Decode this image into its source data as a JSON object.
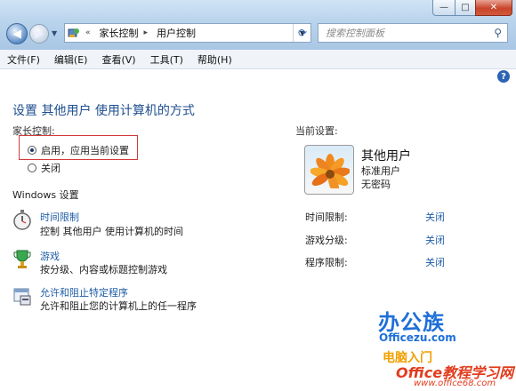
{
  "window": {
    "caption": {
      "minimize": "—",
      "maximize": "□",
      "close": "✕"
    }
  },
  "nav": {
    "breadcrumbs": [
      "家长控制",
      "用户控制"
    ],
    "breadcrumb_prefix": "«",
    "search_placeholder": "搜索控制面板"
  },
  "menu": [
    "文件(F)",
    "编辑(E)",
    "查看(V)",
    "工具(T)",
    "帮助(H)"
  ],
  "main": {
    "title": "设置 其他用户 使用计算机的方式",
    "parental_label": "家长控制:",
    "options": [
      {
        "label": "启用，应用当前设置",
        "selected": true
      },
      {
        "label": "关闭",
        "selected": false
      }
    ],
    "windows_settings_title": "Windows 设置",
    "settings": [
      {
        "link": "时间限制",
        "desc": "控制 其他用户 使用计算机的时间",
        "icon": "stopwatch-icon"
      },
      {
        "link": "游戏",
        "desc": "按分级、内容或标题控制游戏",
        "icon": "trophy-icon"
      },
      {
        "link": "允许和阻止特定程序",
        "desc": "允许和阻止您的计算机上的任一程序",
        "icon": "program-icon"
      }
    ]
  },
  "current": {
    "label": "当前设置:",
    "user_name": "其他用户",
    "user_type": "标准用户",
    "password": "无密码",
    "rows": [
      {
        "label": "时间限制:",
        "value": "关闭"
      },
      {
        "label": "游戏分级:",
        "value": "关闭"
      },
      {
        "label": "程序限制:",
        "value": "关闭"
      }
    ]
  },
  "watermarks": {
    "brand": "办公族",
    "brand_url": "Officezu.com",
    "brand_sub": "电脑入门",
    "site": "Office教程学习网",
    "site_url": "www.office68.com"
  },
  "colors": {
    "link": "#1f5da6",
    "title": "#1f4f8f",
    "highlight_box": "#d23b3b"
  }
}
